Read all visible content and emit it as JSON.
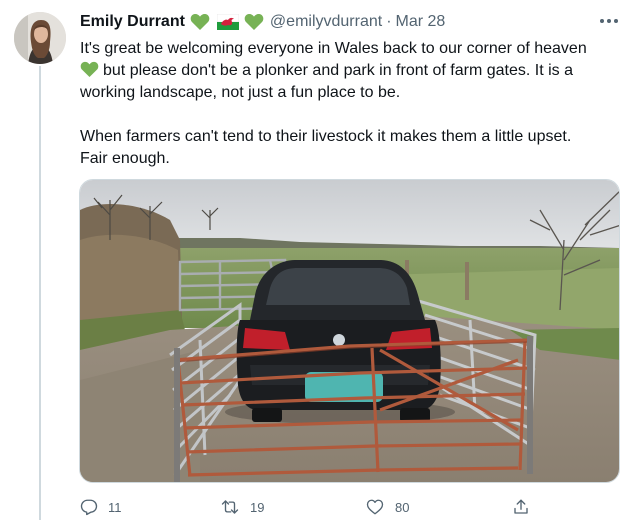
{
  "tweet": {
    "author_name": "Emily Durrant",
    "handle": "@emilyvdurrant",
    "separator": "·",
    "date": "Mar 28",
    "text_lines": [
      "It's great be welcoming everyone in Wales back to our corner of heaven",
      "but please don't be a plonker and park in front of farm gates. It is a",
      "working landscape, not just a fun place to be.",
      "When farmers can't tend to their livestock it makes them a little upset.",
      "Fair enough."
    ],
    "inline_emoji": "green-heart-icon",
    "name_emojis": [
      "green-heart-icon",
      "wales-flag-icon",
      "green-heart-icon"
    ],
    "image_subject": "farm-gate-photo"
  },
  "actions": {
    "reply_count": "11",
    "retweet_count": "19",
    "like_count": "80",
    "share_icon": "share-icon"
  },
  "colors": {
    "text": "#0f1419",
    "secondary": "#536471",
    "green_heart": "#77b255",
    "thread_line": "#cfd9de"
  }
}
